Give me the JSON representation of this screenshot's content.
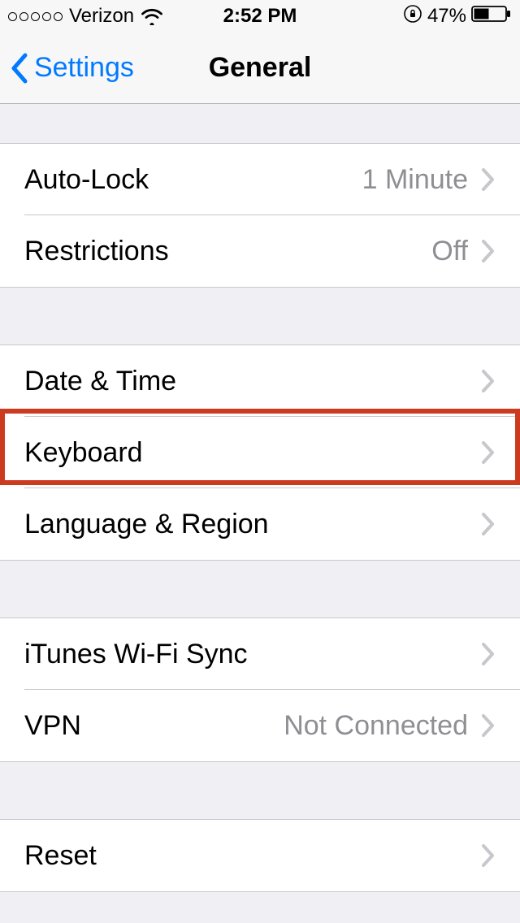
{
  "status": {
    "carrier": "Verizon",
    "time": "2:52 PM",
    "battery_pct": "47%"
  },
  "nav": {
    "back_label": "Settings",
    "title": "General"
  },
  "groups": [
    {
      "rows": [
        {
          "label": "Auto-Lock",
          "value": "1 Minute"
        },
        {
          "label": "Restrictions",
          "value": "Off"
        }
      ]
    },
    {
      "rows": [
        {
          "label": "Date & Time",
          "value": ""
        },
        {
          "label": "Keyboard",
          "value": ""
        },
        {
          "label": "Language & Region",
          "value": ""
        }
      ]
    },
    {
      "rows": [
        {
          "label": "iTunes Wi-Fi Sync",
          "value": ""
        },
        {
          "label": "VPN",
          "value": "Not Connected"
        }
      ]
    },
    {
      "rows": [
        {
          "label": "Reset",
          "value": ""
        }
      ]
    }
  ]
}
